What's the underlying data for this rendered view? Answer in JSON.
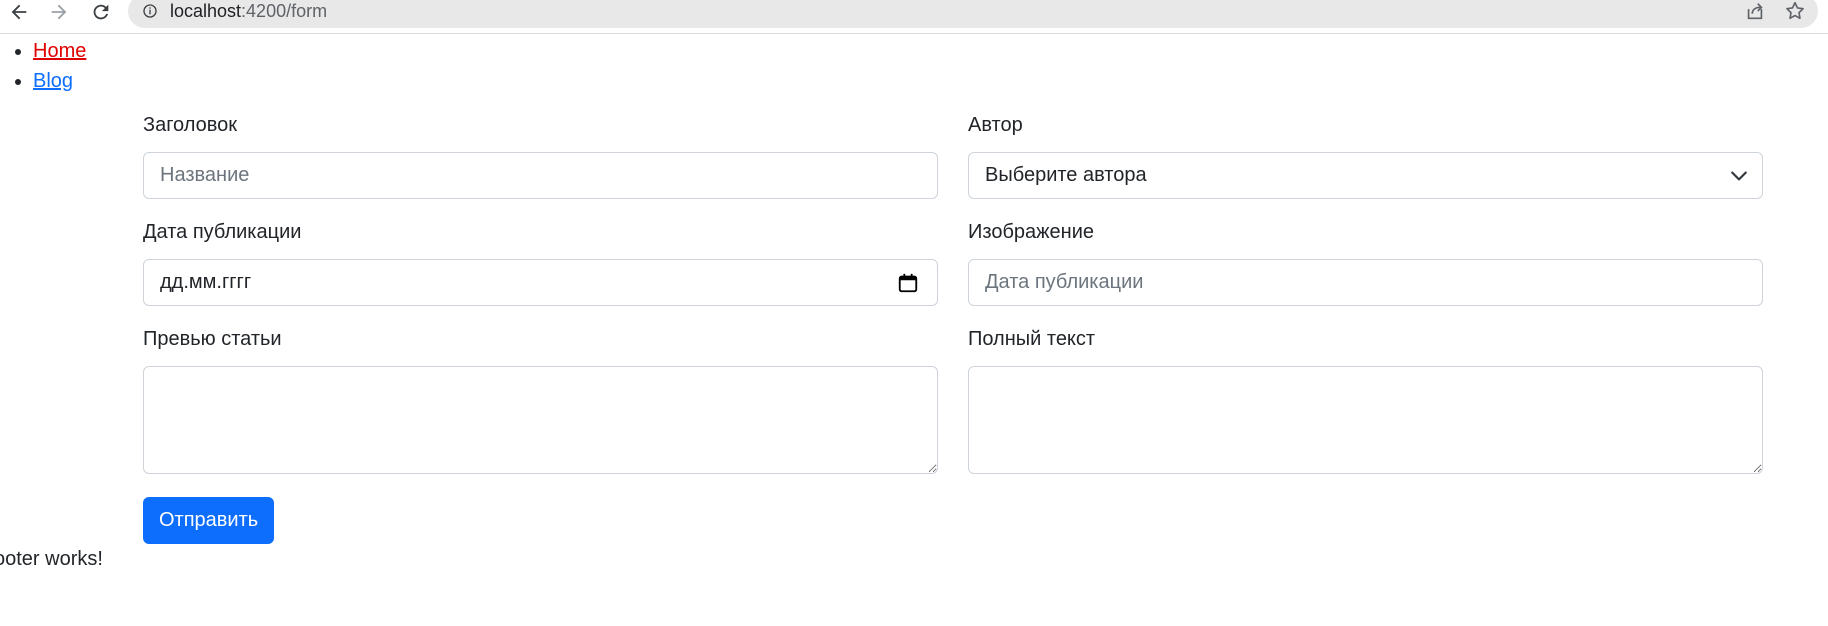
{
  "browser": {
    "url_host": "localhost",
    "url_path": ":4200/form",
    "icons": {
      "back": "arrow-left-icon",
      "forward": "arrow-right-icon",
      "reload": "reload-icon",
      "info": "info-icon",
      "share": "share-icon",
      "bookmark": "star-icon"
    }
  },
  "nav": {
    "items": [
      {
        "label": "Home",
        "state": "active"
      },
      {
        "label": "Blog",
        "state": "normal"
      }
    ]
  },
  "form": {
    "title_label": "Заголовок",
    "title_placeholder": "Название",
    "author_label": "Автор",
    "author_selected": "Выберите автора",
    "date_label": "Дата публикации",
    "date_value": "дд.мм.гггг",
    "image_label": "Изображение",
    "image_placeholder": "Дата публикации",
    "preview_label": "Превью статьи",
    "fulltext_label": "Полный текст",
    "submit_label": "Отправить"
  },
  "footer": {
    "text": "ooter works!"
  },
  "colors": {
    "primary": "#0d6efd",
    "active_link": "#e00000",
    "border": "#ced4da",
    "placeholder": "#6c757d"
  }
}
